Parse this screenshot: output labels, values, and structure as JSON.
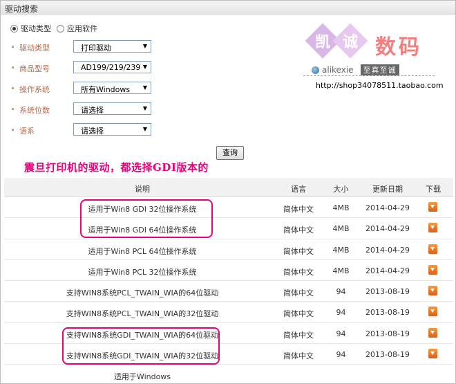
{
  "panel_title": "驱动搜索",
  "search_type": {
    "options": [
      {
        "label": "驱动类型",
        "checked": true
      },
      {
        "label": "应用软件",
        "checked": false
      }
    ]
  },
  "filters": [
    {
      "label": "驱动类型",
      "value": "打印驱动"
    },
    {
      "label": "商品型号",
      "value": "AD199/219/239"
    },
    {
      "label": "操作系统",
      "value": "所有Windows"
    },
    {
      "label": "系统位数",
      "value": "请选择"
    },
    {
      "label": "语系",
      "value": "请选择"
    }
  ],
  "query_button": "查询",
  "annotation": "震旦打印机的驱动，都选择GDI版本的",
  "watermark": {
    "glyph1": "凯",
    "glyph2": "诚",
    "brand": "数码",
    "user": "alikexie",
    "badge": "至真至诚",
    "url": "http://shop34078511.taobao.com"
  },
  "table": {
    "headers": {
      "desc": "说明",
      "lang": "语言",
      "size": "大小",
      "date": "更新日期",
      "download": "下载"
    },
    "rows": [
      {
        "desc": "适用于Win8 GDI 32位操作系统",
        "lang": "简体中文",
        "size": "4MB",
        "date": "2014-04-29",
        "download": "download-icon"
      },
      {
        "desc": "适用于Win8 GDI 64位操作系统",
        "lang": "简体中文",
        "size": "4MB",
        "date": "2014-04-29",
        "download": "download-icon"
      },
      {
        "desc": "适用于Win8 PCL 64位操作系统",
        "lang": "简体中文",
        "size": "4MB",
        "date": "2014-04-29",
        "download": "download-icon"
      },
      {
        "desc": "适用于Win8 PCL 32位操作系统",
        "lang": "简体中文",
        "size": "4MB",
        "date": "2014-04-29",
        "download": "download-icon"
      },
      {
        "desc": "支持WIN8系统PCL_TWAIN_WIA的64位驱动",
        "lang": "简体中文",
        "size": "94",
        "date": "2013-08-19",
        "download": "download-icon"
      },
      {
        "desc": "支持WIN8系统PCL_TWAIN_WIA的32位驱动",
        "lang": "简体中文",
        "size": "94",
        "date": "2013-08-19",
        "download": "download-icon"
      },
      {
        "desc": "支持WIN8系统GDI_TWAIN_WIA的64位驱动",
        "lang": "简体中文",
        "size": "94",
        "date": "2013-08-19",
        "download": "download-icon"
      },
      {
        "desc": "支持WIN8系统GDI_TWAIN_WIA的32位驱动",
        "lang": "简体中文",
        "size": "94",
        "date": "2013-08-19",
        "download": "download-icon"
      },
      {
        "desc": "适用于Windows",
        "lang": "",
        "size": "",
        "date": "",
        "download": ""
      }
    ]
  },
  "colors": {
    "annotation": "#e8007a",
    "label": "#b46a4a",
    "download": "#e87a2a"
  }
}
